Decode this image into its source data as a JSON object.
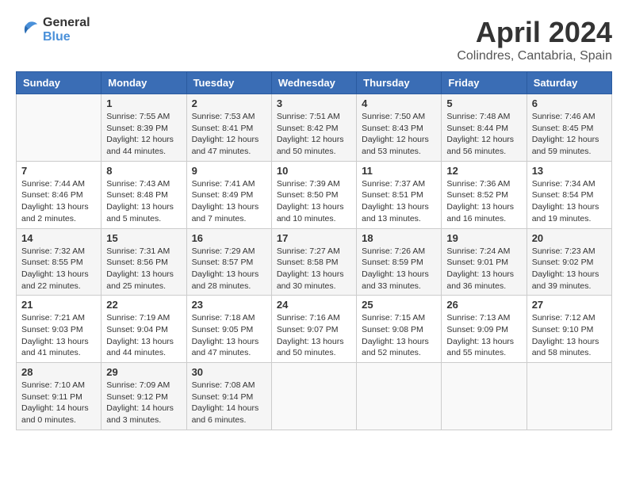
{
  "logo": {
    "line1": "General",
    "line2": "Blue"
  },
  "title": "April 2024",
  "subtitle": "Colindres, Cantabria, Spain",
  "weekdays": [
    "Sunday",
    "Monday",
    "Tuesday",
    "Wednesday",
    "Thursday",
    "Friday",
    "Saturday"
  ],
  "weeks": [
    [
      {
        "day": "",
        "info": ""
      },
      {
        "day": "1",
        "info": "Sunrise: 7:55 AM\nSunset: 8:39 PM\nDaylight: 12 hours\nand 44 minutes."
      },
      {
        "day": "2",
        "info": "Sunrise: 7:53 AM\nSunset: 8:41 PM\nDaylight: 12 hours\nand 47 minutes."
      },
      {
        "day": "3",
        "info": "Sunrise: 7:51 AM\nSunset: 8:42 PM\nDaylight: 12 hours\nand 50 minutes."
      },
      {
        "day": "4",
        "info": "Sunrise: 7:50 AM\nSunset: 8:43 PM\nDaylight: 12 hours\nand 53 minutes."
      },
      {
        "day": "5",
        "info": "Sunrise: 7:48 AM\nSunset: 8:44 PM\nDaylight: 12 hours\nand 56 minutes."
      },
      {
        "day": "6",
        "info": "Sunrise: 7:46 AM\nSunset: 8:45 PM\nDaylight: 12 hours\nand 59 minutes."
      }
    ],
    [
      {
        "day": "7",
        "info": "Sunrise: 7:44 AM\nSunset: 8:46 PM\nDaylight: 13 hours\nand 2 minutes."
      },
      {
        "day": "8",
        "info": "Sunrise: 7:43 AM\nSunset: 8:48 PM\nDaylight: 13 hours\nand 5 minutes."
      },
      {
        "day": "9",
        "info": "Sunrise: 7:41 AM\nSunset: 8:49 PM\nDaylight: 13 hours\nand 7 minutes."
      },
      {
        "day": "10",
        "info": "Sunrise: 7:39 AM\nSunset: 8:50 PM\nDaylight: 13 hours\nand 10 minutes."
      },
      {
        "day": "11",
        "info": "Sunrise: 7:37 AM\nSunset: 8:51 PM\nDaylight: 13 hours\nand 13 minutes."
      },
      {
        "day": "12",
        "info": "Sunrise: 7:36 AM\nSunset: 8:52 PM\nDaylight: 13 hours\nand 16 minutes."
      },
      {
        "day": "13",
        "info": "Sunrise: 7:34 AM\nSunset: 8:54 PM\nDaylight: 13 hours\nand 19 minutes."
      }
    ],
    [
      {
        "day": "14",
        "info": "Sunrise: 7:32 AM\nSunset: 8:55 PM\nDaylight: 13 hours\nand 22 minutes."
      },
      {
        "day": "15",
        "info": "Sunrise: 7:31 AM\nSunset: 8:56 PM\nDaylight: 13 hours\nand 25 minutes."
      },
      {
        "day": "16",
        "info": "Sunrise: 7:29 AM\nSunset: 8:57 PM\nDaylight: 13 hours\nand 28 minutes."
      },
      {
        "day": "17",
        "info": "Sunrise: 7:27 AM\nSunset: 8:58 PM\nDaylight: 13 hours\nand 30 minutes."
      },
      {
        "day": "18",
        "info": "Sunrise: 7:26 AM\nSunset: 8:59 PM\nDaylight: 13 hours\nand 33 minutes."
      },
      {
        "day": "19",
        "info": "Sunrise: 7:24 AM\nSunset: 9:01 PM\nDaylight: 13 hours\nand 36 minutes."
      },
      {
        "day": "20",
        "info": "Sunrise: 7:23 AM\nSunset: 9:02 PM\nDaylight: 13 hours\nand 39 minutes."
      }
    ],
    [
      {
        "day": "21",
        "info": "Sunrise: 7:21 AM\nSunset: 9:03 PM\nDaylight: 13 hours\nand 41 minutes."
      },
      {
        "day": "22",
        "info": "Sunrise: 7:19 AM\nSunset: 9:04 PM\nDaylight: 13 hours\nand 44 minutes."
      },
      {
        "day": "23",
        "info": "Sunrise: 7:18 AM\nSunset: 9:05 PM\nDaylight: 13 hours\nand 47 minutes."
      },
      {
        "day": "24",
        "info": "Sunrise: 7:16 AM\nSunset: 9:07 PM\nDaylight: 13 hours\nand 50 minutes."
      },
      {
        "day": "25",
        "info": "Sunrise: 7:15 AM\nSunset: 9:08 PM\nDaylight: 13 hours\nand 52 minutes."
      },
      {
        "day": "26",
        "info": "Sunrise: 7:13 AM\nSunset: 9:09 PM\nDaylight: 13 hours\nand 55 minutes."
      },
      {
        "day": "27",
        "info": "Sunrise: 7:12 AM\nSunset: 9:10 PM\nDaylight: 13 hours\nand 58 minutes."
      }
    ],
    [
      {
        "day": "28",
        "info": "Sunrise: 7:10 AM\nSunset: 9:11 PM\nDaylight: 14 hours\nand 0 minutes."
      },
      {
        "day": "29",
        "info": "Sunrise: 7:09 AM\nSunset: 9:12 PM\nDaylight: 14 hours\nand 3 minutes."
      },
      {
        "day": "30",
        "info": "Sunrise: 7:08 AM\nSunset: 9:14 PM\nDaylight: 14 hours\nand 6 minutes."
      },
      {
        "day": "",
        "info": ""
      },
      {
        "day": "",
        "info": ""
      },
      {
        "day": "",
        "info": ""
      },
      {
        "day": "",
        "info": ""
      }
    ]
  ]
}
